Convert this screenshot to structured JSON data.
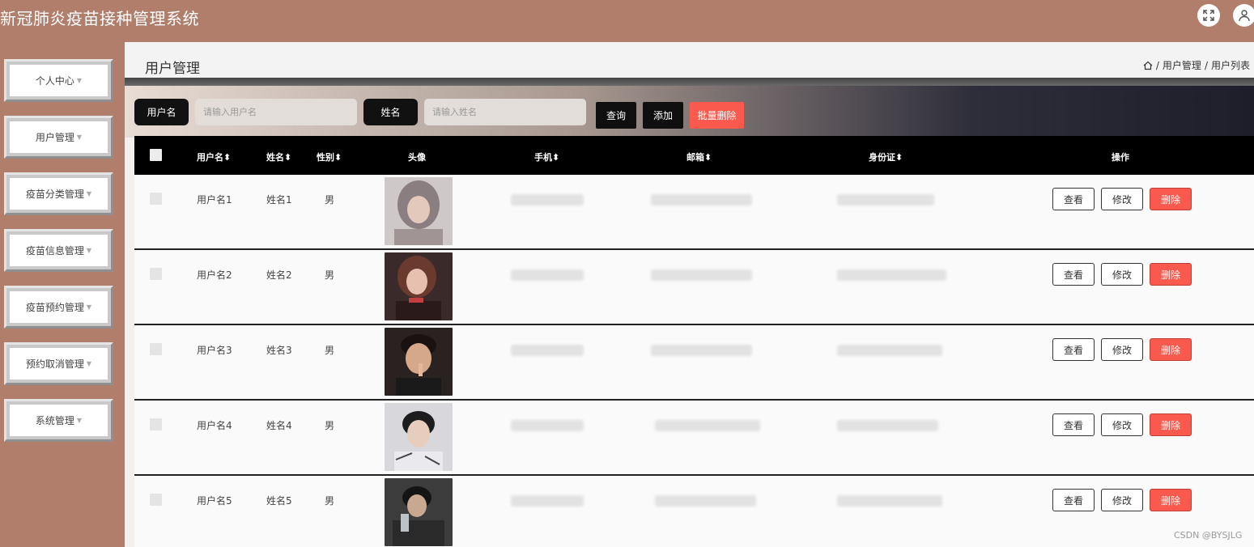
{
  "app": {
    "title": "新冠肺炎疫苗接种管理系统"
  },
  "sidebar": {
    "items": [
      {
        "label": "个人中心"
      },
      {
        "label": "用户管理"
      },
      {
        "label": "疫苗分类管理"
      },
      {
        "label": "疫苗信息管理"
      },
      {
        "label": "疫苗预约管理"
      },
      {
        "label": "预约取消管理"
      },
      {
        "label": "系统管理"
      }
    ]
  },
  "page": {
    "title": "用户管理",
    "breadcrumb": [
      "用户管理",
      "用户列表"
    ],
    "breadcrumb_sep": "/"
  },
  "search": {
    "username_label": "用户名",
    "username_placeholder": "请输入用户名",
    "name_label": "姓名",
    "name_placeholder": "请输入姓名",
    "query_button": "查询",
    "add_button": "添加",
    "batch_delete_button": "批量删除"
  },
  "table": {
    "headers": {
      "username": "用户名",
      "name": "姓名",
      "gender": "性别",
      "avatar": "头像",
      "phone": "手机",
      "email": "邮箱",
      "idcard": "身份证",
      "actions": "操作"
    },
    "sort_glyph": "⬍",
    "rows": [
      {
        "username": "用户名1",
        "name": "姓名1",
        "gender": "男"
      },
      {
        "username": "用户名2",
        "name": "姓名2",
        "gender": "男"
      },
      {
        "username": "用户名3",
        "name": "姓名3",
        "gender": "男"
      },
      {
        "username": "用户名4",
        "name": "姓名4",
        "gender": "男"
      },
      {
        "username": "用户名5",
        "name": "姓名5",
        "gender": "男"
      }
    ],
    "actions": {
      "view": "查看",
      "edit": "修改",
      "delete": "删除"
    }
  },
  "watermark": "CSDN @BYSJLG",
  "colors": {
    "brand": "#b07e6b",
    "danger": "#fa5a4e",
    "dark": "#0f0f0f"
  }
}
